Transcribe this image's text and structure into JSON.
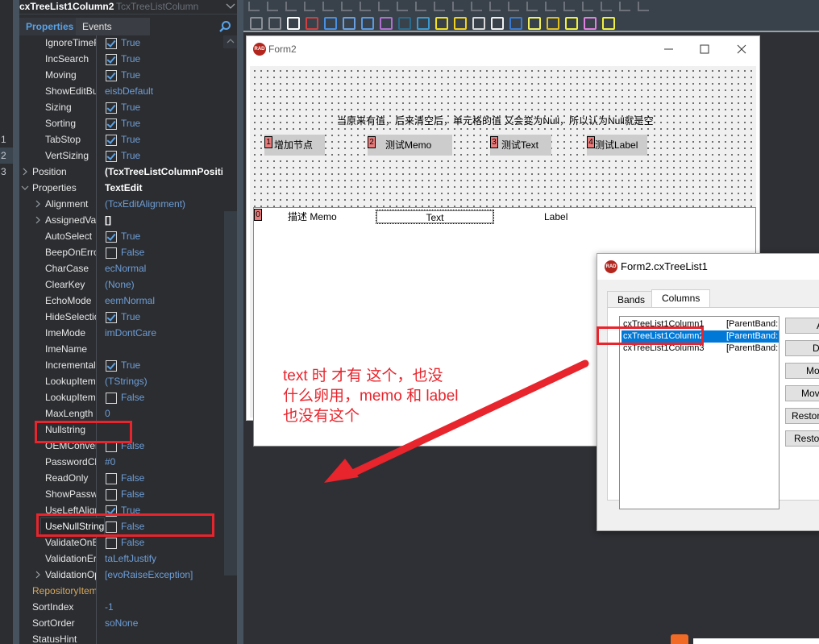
{
  "gutter": {
    "line_numbers": [
      "1",
      "2",
      "3"
    ],
    "selected_line": "2"
  },
  "inspector": {
    "object_name": "cxTreeList1Column2",
    "object_type": "TcxTreeListColumn",
    "tabs": [
      {
        "label": "Properties",
        "active": true
      },
      {
        "label": "Events",
        "active": false
      }
    ],
    "rows": [
      {
        "name": "IgnoreTimeF",
        "level": 1,
        "type": "check",
        "checked": true,
        "value": "True"
      },
      {
        "name": "IncSearch",
        "level": 1,
        "type": "check",
        "checked": true,
        "value": "True"
      },
      {
        "name": "Moving",
        "level": 1,
        "type": "check",
        "checked": true,
        "value": "True"
      },
      {
        "name": "ShowEditBu",
        "level": 1,
        "type": "text",
        "value": "eisbDefault"
      },
      {
        "name": "Sizing",
        "level": 1,
        "type": "check",
        "checked": true,
        "value": "True"
      },
      {
        "name": "Sorting",
        "level": 1,
        "type": "check",
        "checked": true,
        "value": "True"
      },
      {
        "name": "TabStop",
        "level": 1,
        "type": "check",
        "checked": true,
        "value": "True"
      },
      {
        "name": "VertSizing",
        "level": 1,
        "type": "check",
        "checked": true,
        "value": "True"
      },
      {
        "name": "Position",
        "level": 0,
        "type": "bold",
        "expander": "collapsed",
        "value": "(TcxTreeListColumnPosition)"
      },
      {
        "name": "Properties",
        "level": 0,
        "type": "bold",
        "expander": "expanded",
        "value": "TextEdit"
      },
      {
        "name": "Alignment",
        "level": 1,
        "type": "text",
        "expander": "collapsed",
        "value": "(TcxEditAlignment)"
      },
      {
        "name": "AssignedVal",
        "level": 1,
        "type": "bold",
        "expander": "collapsed",
        "value": "[]"
      },
      {
        "name": "AutoSelect",
        "level": 1,
        "type": "check",
        "checked": true,
        "value": "True"
      },
      {
        "name": "BeepOnError",
        "level": 1,
        "type": "check",
        "checked": false,
        "value": "False"
      },
      {
        "name": "CharCase",
        "level": 1,
        "type": "text",
        "value": "ecNormal"
      },
      {
        "name": "ClearKey",
        "level": 1,
        "type": "text",
        "value": "(None)"
      },
      {
        "name": "EchoMode",
        "level": 1,
        "type": "text",
        "value": "eemNormal"
      },
      {
        "name": "HideSelection",
        "level": 1,
        "type": "check",
        "checked": true,
        "value": "True"
      },
      {
        "name": "ImeMode",
        "level": 1,
        "type": "text",
        "value": "imDontCare"
      },
      {
        "name": "ImeName",
        "level": 1,
        "type": "text",
        "value": ""
      },
      {
        "name": "Incremental",
        "level": 1,
        "type": "check",
        "checked": true,
        "value": "True"
      },
      {
        "name": "LookupItem",
        "level": 1,
        "type": "text",
        "value": "(TStrings)"
      },
      {
        "name": "LookupItem",
        "level": 1,
        "type": "check",
        "checked": false,
        "value": "False"
      },
      {
        "name": "MaxLength",
        "level": 1,
        "type": "text",
        "value": "0"
      },
      {
        "name": "Nullstring",
        "level": 1,
        "type": "text",
        "value": ""
      },
      {
        "name": "OEMConvert",
        "level": 1,
        "type": "check",
        "checked": false,
        "value": "False"
      },
      {
        "name": "PasswordCh",
        "level": 1,
        "type": "text",
        "value": "#0"
      },
      {
        "name": "ReadOnly",
        "level": 1,
        "type": "check",
        "checked": false,
        "value": "False"
      },
      {
        "name": "ShowPassword",
        "level": 1,
        "type": "check",
        "checked": false,
        "value": "False"
      },
      {
        "name": "UseLeftAlign",
        "level": 1,
        "type": "check",
        "checked": true,
        "value": "True"
      },
      {
        "name": "UseNullString",
        "level": 1,
        "type": "check",
        "checked": false,
        "value": "False"
      },
      {
        "name": "ValidateOnE",
        "level": 1,
        "type": "check",
        "checked": false,
        "value": "False"
      },
      {
        "name": "ValidationEr",
        "level": 1,
        "type": "text",
        "value": "taLeftJustify"
      },
      {
        "name": "ValidationOp",
        "level": 1,
        "type": "text",
        "expander": "collapsed",
        "value": "[evoRaiseException]"
      },
      {
        "name": "RepositoryItem",
        "level": 0,
        "type": "category",
        "value": ""
      },
      {
        "name": "SortIndex",
        "level": 0,
        "type": "text",
        "value": "-1"
      },
      {
        "name": "SortOrder",
        "level": 0,
        "type": "text",
        "value": "soNone"
      },
      {
        "name": "StatusHint",
        "level": 0,
        "type": "text",
        "value": ""
      }
    ],
    "tooltip": "UseNullString"
  },
  "form2": {
    "title": "Form2",
    "caption": "当原来有值，后来清空后，单元格的值 又会变为Null，所以认为Null就是空",
    "buttons": [
      {
        "order": "1",
        "label": "增加节点"
      },
      {
        "order": "2",
        "label": "测试Memo"
      },
      {
        "order": "3",
        "label": "测试Text"
      },
      {
        "order": "4",
        "label": "测试Label"
      }
    ],
    "treelist": {
      "order": "0",
      "columns": [
        "描述 Memo",
        "Text",
        "Label"
      ]
    }
  },
  "annotation": {
    "lines": [
      "text 时 才有 这个，也没",
      "什么卵用，memo 和 label",
      "也没有这个"
    ],
    "color": "#e8242c"
  },
  "dialog": {
    "title": "Form2.cxTreeList1",
    "tabs": [
      {
        "label": "Bands",
        "active": false
      },
      {
        "label": "Columns",
        "active": true
      }
    ],
    "items": [
      {
        "name": "cxTreeList1Column1",
        "band": "[ParentBand:",
        "selected": false
      },
      {
        "name": "cxTreeList1Column2",
        "band": "[ParentBand:",
        "selected": true
      },
      {
        "name": "cxTreeList1Column3",
        "band": "[ParentBand:",
        "selected": false
      }
    ],
    "buttons": [
      "Add",
      "Delete",
      "Move Up",
      "Move Down",
      "Restore",
      "Restore"
    ]
  },
  "colors": {
    "accent": "#5aa2e6",
    "callout": "#e8242c",
    "selection": "#0078d7"
  }
}
